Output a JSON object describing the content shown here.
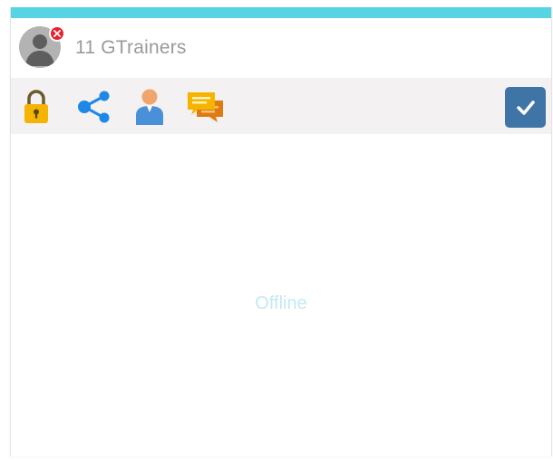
{
  "header": {
    "trainer_name": "11 GTrainers",
    "status_color": "#e8212b",
    "accent_color": "#56d4e4"
  },
  "toolbar": {
    "tools": [
      {
        "icon": "lock-icon",
        "color": "#f4b400"
      },
      {
        "icon": "share-icon",
        "color": "#1e88e5"
      },
      {
        "icon": "user-icon",
        "color": "#4a90d9"
      },
      {
        "icon": "chat-icon",
        "color": "#f39c12"
      }
    ],
    "confirm_icon": "checkmark-icon",
    "confirm_color": "#3f74a7"
  },
  "content": {
    "status_text": "Offline"
  }
}
